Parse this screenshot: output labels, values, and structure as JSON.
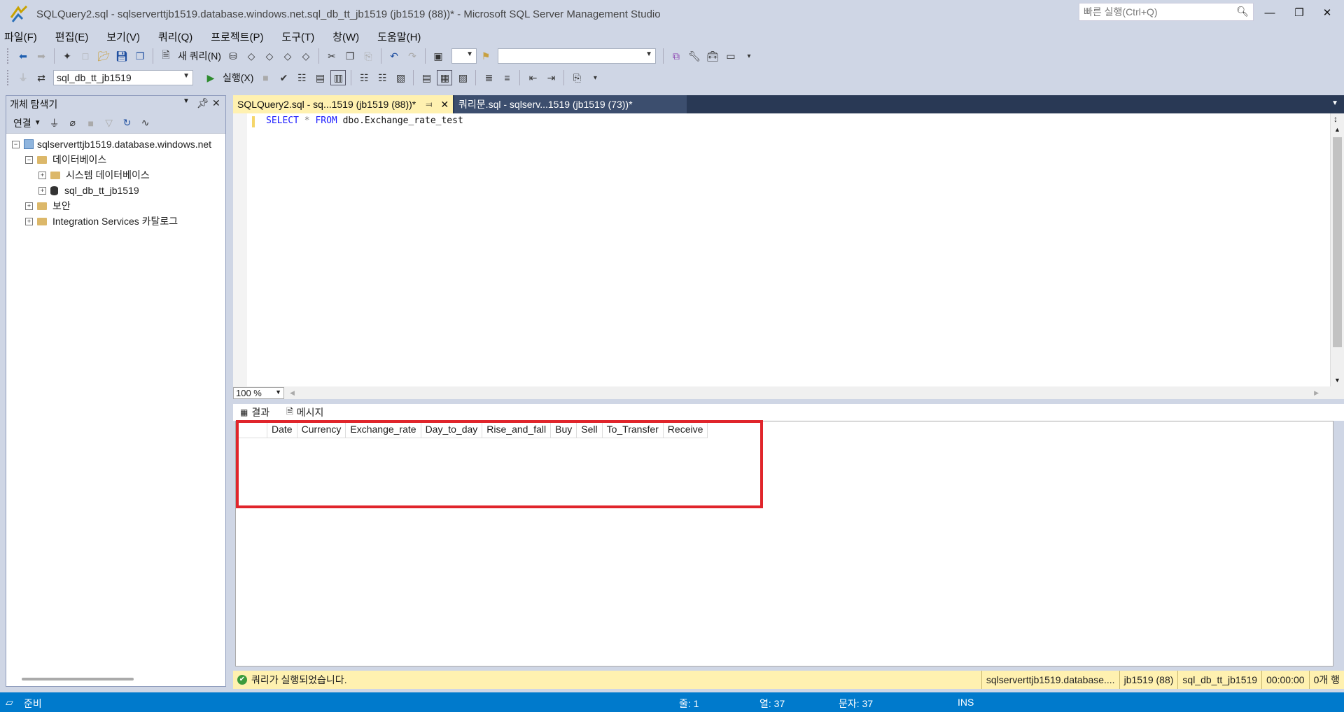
{
  "window": {
    "title": "SQLQuery2.sql - sqlserverttjb1519.database.windows.net.sql_db_tt_jb1519 (jb1519 (88))* - Microsoft SQL Server Management Studio",
    "quick_launch_placeholder": "빠른 실행(Ctrl+Q)"
  },
  "menu": [
    "파일(F)",
    "편집(E)",
    "보기(V)",
    "쿼리(Q)",
    "프로젝트(P)",
    "도구(T)",
    "창(W)",
    "도움말(H)"
  ],
  "toolbar": {
    "new_query_label": "새 쿼리(N)",
    "execute_label": "실행(X)",
    "database_selected": "sql_db_tt_jb1519",
    "solution_config": ""
  },
  "object_explorer": {
    "title": "개체 탐색기",
    "connect_label": "연결",
    "tree": {
      "server": "sqlserverttjb1519.database.windows.net",
      "databases": "데이터베이스",
      "system_databases": "시스템 데이터베이스",
      "user_db": "sql_db_tt_jb1519",
      "security": "보안",
      "integration": "Integration Services 카탈로그"
    }
  },
  "tabs": {
    "active": "SQLQuery2.sql - sq...1519 (jb1519 (88))*",
    "inactive": "쿼리문.sql - sqlserv...1519 (jb1519 (73))*"
  },
  "editor": {
    "kw_select": "SELECT",
    "star": "*",
    "kw_from": "FROM",
    "table": "dbo.Exchange_rate_test",
    "zoom": "100 %"
  },
  "results": {
    "tab_results": "결과",
    "tab_messages": "메시지",
    "columns": [
      "Date",
      "Currency",
      "Exchange_rate",
      "Day_to_day",
      "Rise_and_fall",
      "Buy",
      "Sell",
      "To_Transfer",
      "Receive"
    ]
  },
  "query_status": {
    "message": "쿼리가 실행되었습니다.",
    "server": "sqlserverttjb1519.database....",
    "user": "jb1519 (88)",
    "database": "sql_db_tt_jb1519",
    "elapsed": "00:00:00",
    "rows": "0개 행"
  },
  "app_status": {
    "ready": "준비",
    "line": "줄: 1",
    "col": "열: 37",
    "ch": "문자: 37",
    "mode": "INS"
  },
  "colors": {
    "accent": "#007acc",
    "active_tab": "#fff1b0",
    "highlight_box": "#e0252b"
  }
}
